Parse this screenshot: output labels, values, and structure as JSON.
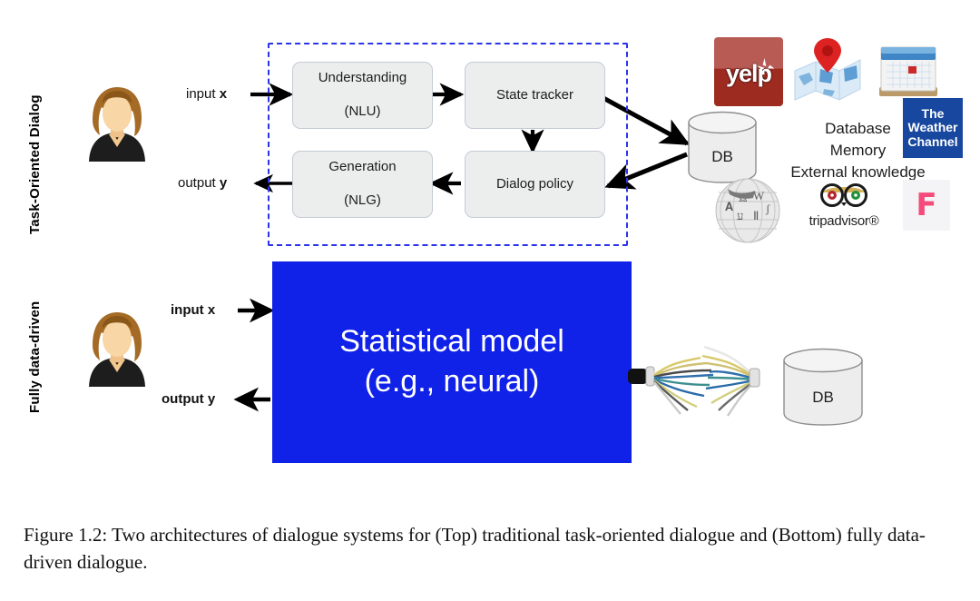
{
  "figure": {
    "caption": "Figure 1.2: Two architectures of dialogue systems for (Top) traditional task-oriented dialogue and (Bottom) fully data-driven dialogue."
  },
  "top_panel": {
    "row_label": "Task-Oriented Dialog",
    "input_label_prefix": "input ",
    "input_label_var": "x",
    "output_label_prefix": "output ",
    "output_label_var": "y",
    "modules": [
      {
        "line1": "Understanding",
        "line2": "(NLU)"
      },
      {
        "line1": "State tracker",
        "line2": ""
      },
      {
        "line1": "Dialog policy",
        "line2": ""
      },
      {
        "line1": "Generation",
        "line2": "(NLG)"
      }
    ],
    "db_label": "DB",
    "knowledge_lines": [
      "Database",
      "Memory",
      "External knowledge"
    ],
    "logos": {
      "yelp": "yelp",
      "map": "map-pin",
      "calendar": "calendar",
      "weather_channel": [
        "The",
        "Weather",
        "Channel"
      ],
      "wikipedia": "wikipedia-globe",
      "tripadvisor": "tripadvisor®",
      "foursquare": "F"
    }
  },
  "bottom_panel": {
    "row_label": "Fully data-driven",
    "input_label_prefix": "input ",
    "input_label_var": "x",
    "output_label_prefix": "output ",
    "output_label_var": "y",
    "model_line1": "Statistical model",
    "model_line2": "(e.g., neural)",
    "db_label": "DB"
  },
  "colors": {
    "dashed_border": "#2a35ea",
    "model_blue": "#1122e8",
    "module_fill": "#eceded",
    "weather_blue": "#17479e",
    "yelp_red": "#9e2b20",
    "foursquare_pink": "#f54b7b"
  }
}
